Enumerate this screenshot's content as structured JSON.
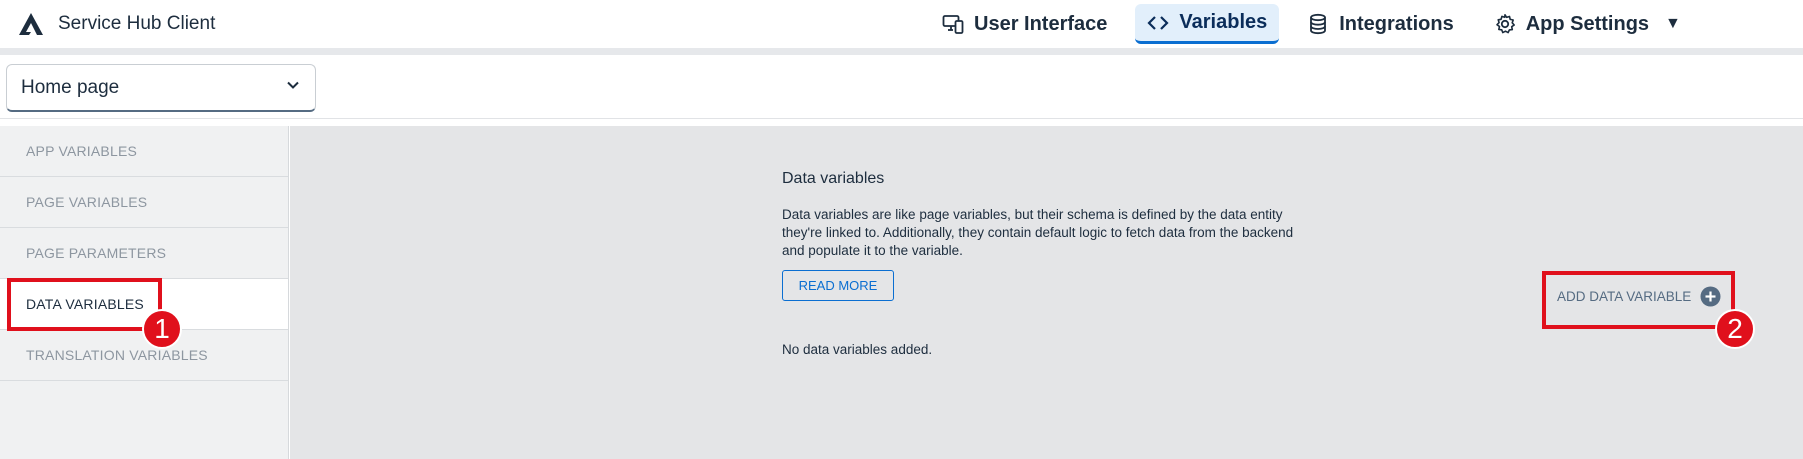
{
  "header": {
    "app_title": "Service Hub Client",
    "nav": [
      {
        "label": "User Interface",
        "icon": "devices-icon",
        "active": false
      },
      {
        "label": "Variables",
        "icon": "code-icon",
        "active": true
      },
      {
        "label": "Integrations",
        "icon": "database-icon",
        "active": false
      },
      {
        "label": "App Settings",
        "icon": "gear-icon",
        "active": false
      }
    ],
    "menu_caret": "▼"
  },
  "page_selector": {
    "value": "Home page"
  },
  "sidebar": {
    "items": [
      {
        "label": "APP VARIABLES",
        "active": false
      },
      {
        "label": "PAGE VARIABLES",
        "active": false
      },
      {
        "label": "PAGE PARAMETERS",
        "active": false
      },
      {
        "label": "DATA VARIABLES",
        "active": true
      },
      {
        "label": "TRANSLATION VARIABLES",
        "active": false
      }
    ]
  },
  "main": {
    "title": "Data variables",
    "description": "Data variables are like page variables, but their schema is defined by the data entity they're linked to. Additionally, they contain default logic to fetch data from the backend and populate it to the variable.",
    "read_more_label": "READ MORE",
    "add_label": "ADD DATA VARIABLE",
    "empty_message": "No data variables added."
  },
  "annotations": [
    {
      "number": "1"
    },
    {
      "number": "2"
    }
  ],
  "colors": {
    "accent": "#0a6ed1",
    "annotation": "#e0101c",
    "active_tab_bg": "#e2effb",
    "content_bg": "#e4e5e7"
  }
}
